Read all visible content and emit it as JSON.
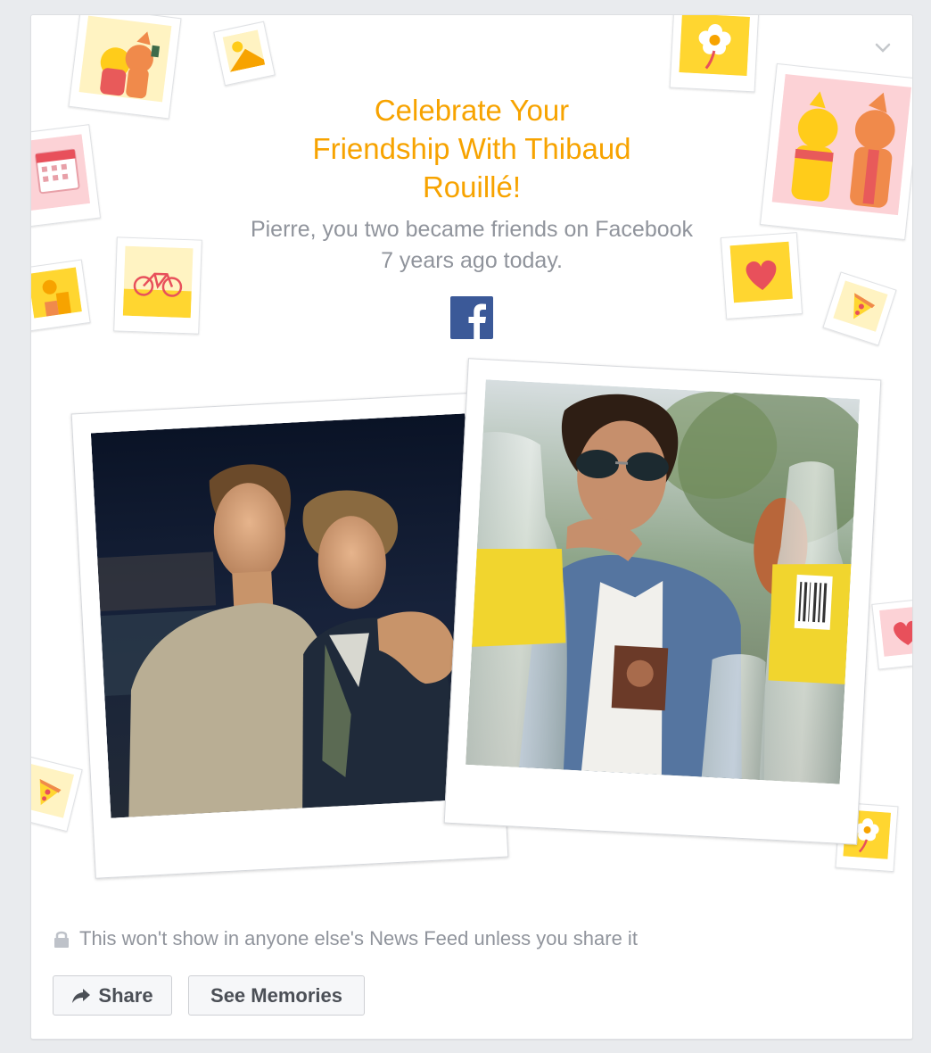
{
  "card": {
    "headline": "Celebrate Your\nFriendship With Thibaud\nRouillé!",
    "subtext_line1": "Pierre, you two became friends on Facebook",
    "subtext_line2": "7 years ago today.",
    "menu_icon": "chevron-down-icon",
    "logo_icon": "facebook-logo-icon"
  },
  "photos": [
    {
      "alt": "Two friends posing together at night"
    },
    {
      "alt": "Friend in sunglasses behind glass bottles"
    }
  ],
  "decorations": [
    "dog-selfie-icon",
    "landscape-photo-icon",
    "flower-icon",
    "dogs-celebrating-icon",
    "calendar-icon",
    "bicycle-icon",
    "heart-icon",
    "pizza-icon",
    "sun-photo-icon",
    "heart-icon",
    "pizza-icon",
    "flower-icon"
  ],
  "privacy": {
    "text": "This won't show in anyone else's News Feed unless you share it",
    "icon": "lock-icon"
  },
  "actions": {
    "share_label": "Share",
    "share_icon": "share-arrow-icon",
    "memories_label": "See Memories"
  },
  "colors": {
    "accent_orange": "#f7a300",
    "text_gray": "#90949c",
    "facebook_blue": "#3b5998",
    "deco_yellow": "#ffd630",
    "deco_pink": "#fcd2d6"
  }
}
